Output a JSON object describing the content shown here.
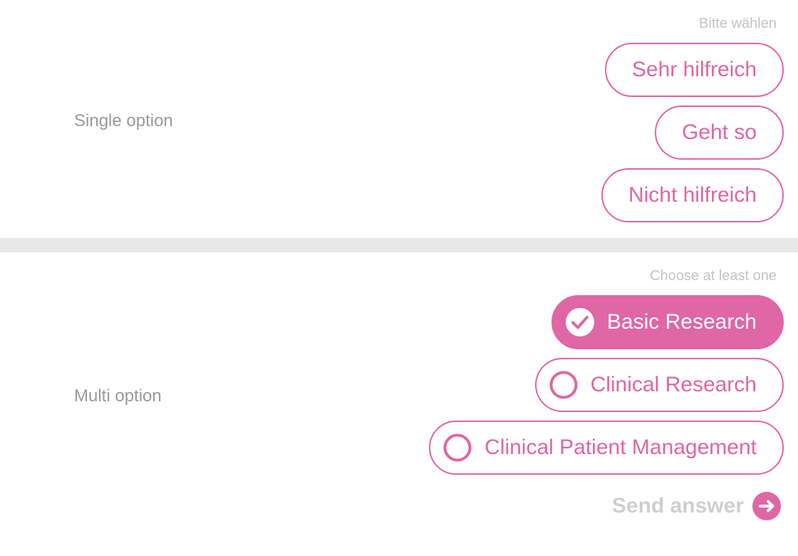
{
  "single": {
    "label": "Single option",
    "hint": "Bitte wählen",
    "options": [
      {
        "label": "Sehr hilfreich",
        "selected": false
      },
      {
        "label": "Geht so",
        "selected": false
      },
      {
        "label": "Nicht hilfreich",
        "selected": false
      }
    ]
  },
  "multi": {
    "label": "Multi option",
    "hint": "Choose at least one",
    "options": [
      {
        "label": "Basic Research",
        "selected": true,
        "icon": "check-circle-icon"
      },
      {
        "label": "Clinical Research",
        "selected": false,
        "icon": "empty-circle-icon"
      },
      {
        "label": "Clinical Patient Management",
        "selected": false,
        "icon": "empty-circle-icon"
      }
    ]
  },
  "send": {
    "label": "Send answer",
    "icon": "arrow-right-circle-icon",
    "enabled": false
  },
  "colors": {
    "accent": "#e066a6",
    "label_gray": "#9a9a9a",
    "hint_gray": "#c4c4c4",
    "divider": "#e8e8e8",
    "send_disabled": "#cfcfcf"
  }
}
